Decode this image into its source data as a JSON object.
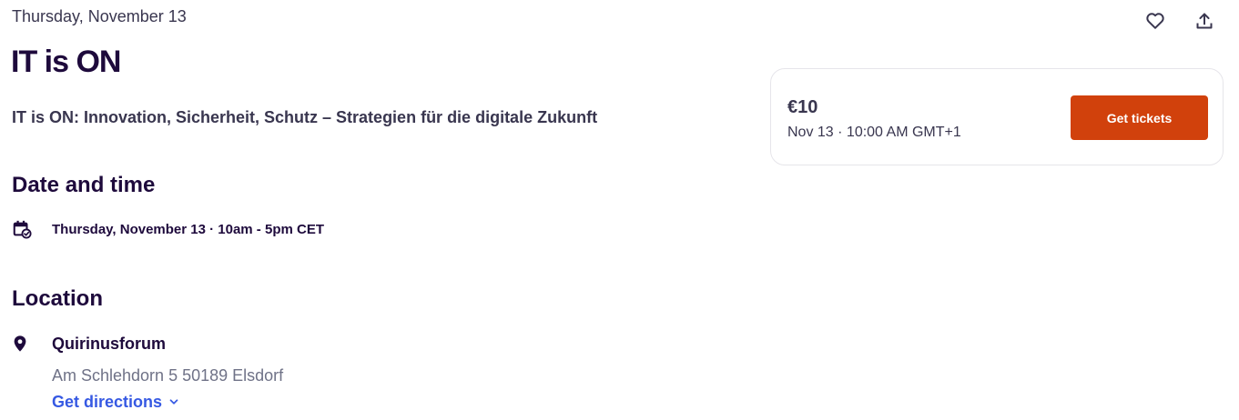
{
  "header": {
    "date": "Thursday, November 13",
    "title": "IT is ON",
    "summary": "IT is ON: Innovation, Sicherheit, Schutz – Strategien für die digitale Zukunft"
  },
  "actions": {
    "like_icon": "heart-icon",
    "share_icon": "share-icon"
  },
  "ticket": {
    "price": "€10",
    "datetime": "Nov 13 · 10:00 AM GMT+1",
    "button_label": "Get tickets",
    "button_color": "#d1410c"
  },
  "date_section": {
    "heading": "Date and time",
    "icon": "calendar-check-icon",
    "text": "Thursday, November 13 · 10am - 5pm CET"
  },
  "location_section": {
    "heading": "Location",
    "icon": "map-pin-icon",
    "venue": "Quirinusforum",
    "address": "Am Schlehdorn 5 50189 Elsdorf",
    "directions_label": "Get directions",
    "link_color": "#3659e3"
  }
}
